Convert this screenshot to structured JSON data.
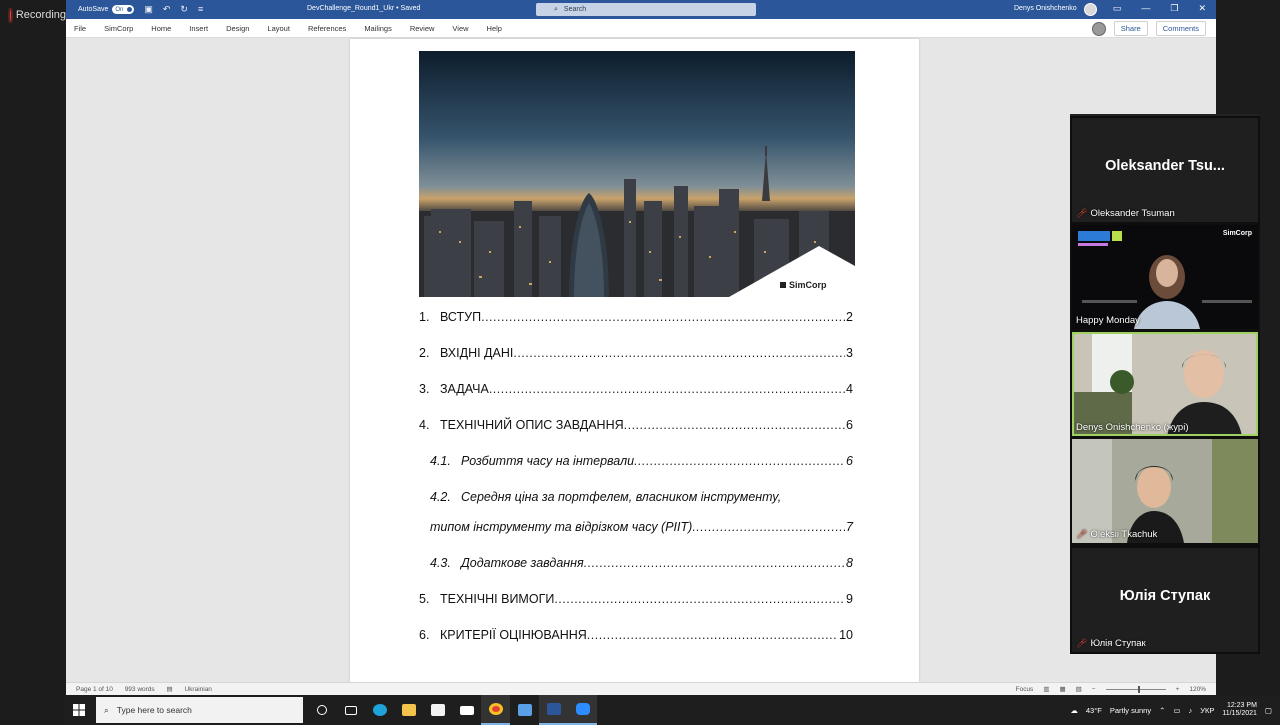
{
  "recording": {
    "label": "Recording"
  },
  "word": {
    "titlebar": {
      "autosave_label": "AutoSave",
      "autosave_state": "On",
      "document_name": "DevChallenge_Round1_Ukr",
      "saved_status": "Saved",
      "search_placeholder": "Search",
      "user_name": "Denys Onishchenko"
    },
    "menu": {
      "tabs": [
        "File",
        "SimCorp",
        "Home",
        "Insert",
        "Design",
        "Layout",
        "References",
        "Mailings",
        "Review",
        "View",
        "Help"
      ],
      "share_label": "Share",
      "comments_label": "Comments"
    },
    "document": {
      "logo_text": "SimCorp",
      "toc": [
        {
          "num": "1.",
          "title": "ВСТУП",
          "page": "2"
        },
        {
          "num": "2.",
          "title": "ВХІДНІ ДАНІ ",
          "page": "3"
        },
        {
          "num": "3.",
          "title": "ЗАДАЧА",
          "page": "4"
        },
        {
          "num": "4.",
          "title": "ТЕХНІЧНИЙ ОПИС ЗАВДАННЯ",
          "page": "6"
        },
        {
          "num": "4.1.",
          "title": "Розбиття часу на інтервали",
          "page": "6"
        },
        {
          "num": "4.2.",
          "title": "Середня ціна за портфелем, власником інструменту,",
          "page": ""
        },
        {
          "num": "",
          "title": "типом інструменту та відрізком часу (PIIT)",
          "page": "7"
        },
        {
          "num": "4.3.",
          "title": "Додаткове завдання",
          "page": "8"
        },
        {
          "num": "5.",
          "title": "ТЕХНІЧНІ ВИМОГИ",
          "page": "9"
        },
        {
          "num": "6.",
          "title": "КРИТЕРІЇ ОЦІНЮВАННЯ ",
          "page": "10"
        }
      ]
    },
    "statusbar": {
      "page_info": "Page 1 of 10",
      "word_count": "993 words",
      "language": "Ukrainian",
      "focus_label": "Focus",
      "zoom_level": "120%"
    }
  },
  "zoom": {
    "participants": [
      {
        "name": "Oleksander Tsuman",
        "tile_title": "Oleksander  Tsu...",
        "muted": true,
        "video": false
      },
      {
        "name": "Happy Monday",
        "muted": false,
        "video": true,
        "brand": "SimCorp"
      },
      {
        "name": "Denys Onishchenko (журі)",
        "muted": false,
        "video": true
      },
      {
        "name": "Oleksii Tkachuk",
        "muted": true,
        "video": true
      },
      {
        "name": "Юлія Ступак",
        "tile_title": "Юлія Ступак",
        "muted": true,
        "video": false
      }
    ]
  },
  "taskbar": {
    "search_placeholder": "Type here to search",
    "weather_temp": "43°F",
    "weather_text": "Partly sunny",
    "language": "УКР",
    "time": "12:23 PM",
    "date": "11/15/2021"
  }
}
